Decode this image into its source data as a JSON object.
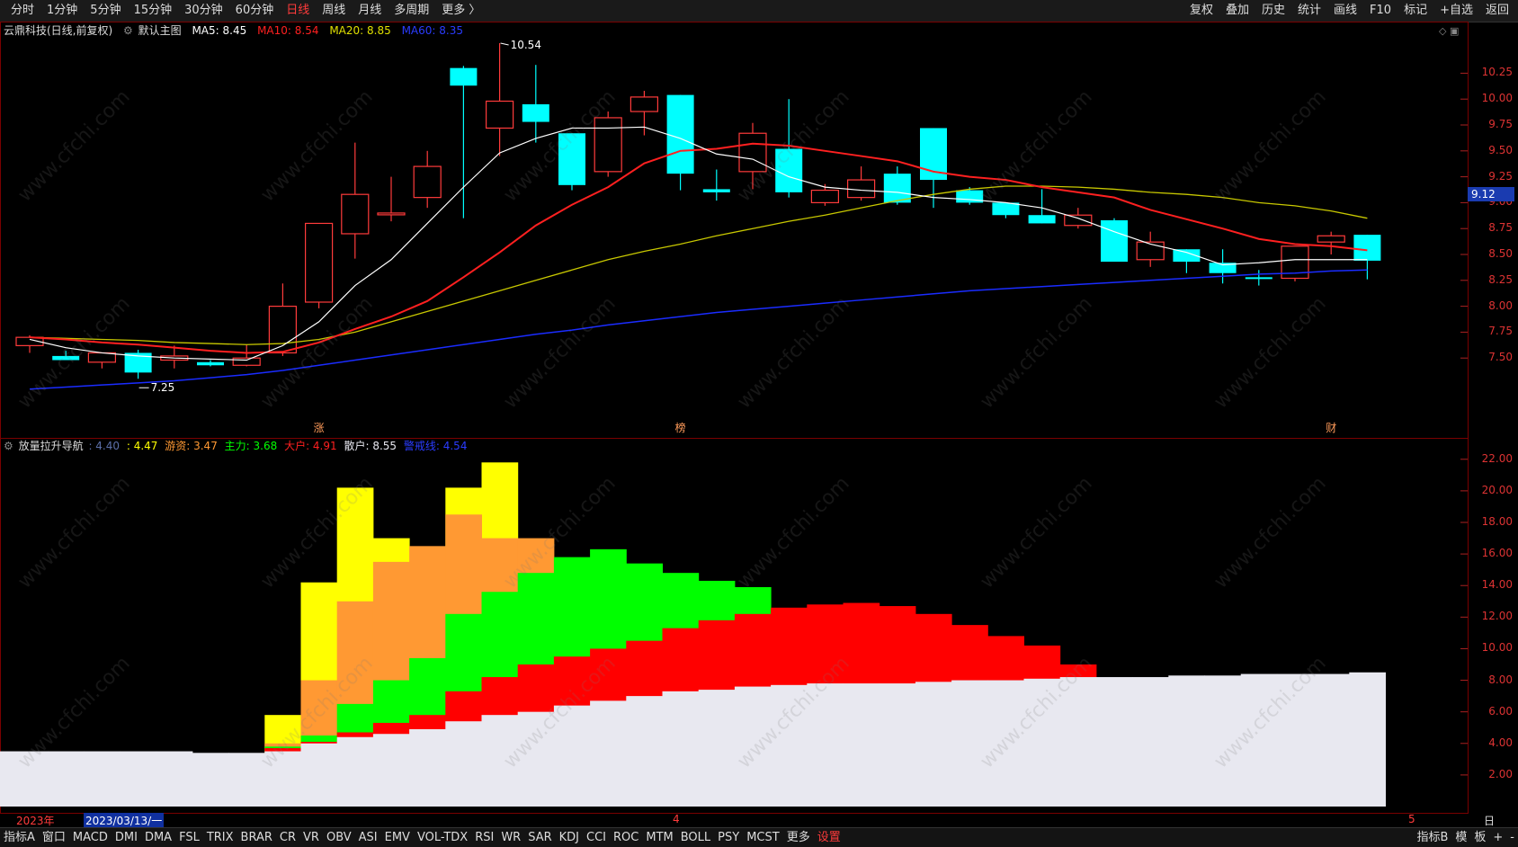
{
  "topbar": {
    "periods": [
      "分时",
      "1分钟",
      "5分钟",
      "15分钟",
      "30分钟",
      "60分钟",
      "日线",
      "周线",
      "月线",
      "多周期",
      "更多 〉"
    ],
    "active_period": "日线",
    "tools": [
      "复权",
      "叠加",
      "历史",
      "统计",
      "画线",
      "F10",
      "标记",
      "+自选",
      "返回"
    ]
  },
  "main_info": {
    "stock": "云鼎科技(日线,前复权)",
    "indicator": "默认主图",
    "ma5": "MA5: 8.45",
    "ma10": "MA10: 8.54",
    "ma20": "MA20: 8.85",
    "ma60": "MA60: 8.35"
  },
  "main_chart": {
    "high_label": "10.54",
    "low_label": "7.25",
    "current_price": "9.12",
    "yticks": [
      "10.25",
      "10.00",
      "9.75",
      "9.50",
      "9.25",
      "9.00",
      "8.75",
      "8.50",
      "8.25",
      "8.00",
      "7.75",
      "7.50"
    ],
    "markers": [
      "涨",
      "榜",
      "财"
    ]
  },
  "sub_info": {
    "name": "放量拉升导航",
    "v1": ": 4.40",
    "v2": ": 4.47",
    "youzi": "游资: 3.47",
    "zhuli": "主力: 3.68",
    "dahu": "大户: 4.91",
    "sanhu": "散户: 8.55",
    "line": "警戒线: 4.54"
  },
  "sub_chart": {
    "yticks": [
      "22.00",
      "20.00",
      "18.00",
      "16.00",
      "14.00",
      "12.00",
      "10.00",
      "8.00",
      "6.00",
      "4.00",
      "2.00"
    ]
  },
  "date_axis": {
    "year": "2023年",
    "cursor_date": "2023/03/13/一",
    "m4": "4",
    "m5": "5"
  },
  "bottom": {
    "left_label": "指标A",
    "window": "窗口",
    "indicators": [
      "MACD",
      "DMI",
      "DMA",
      "FSL",
      "TRIX",
      "BRAR",
      "CR",
      "VR",
      "OBV",
      "ASI",
      "EMV",
      "VOL-TDX",
      "RSI",
      "WR",
      "SAR",
      "KDJ",
      "CCI",
      "ROC",
      "MTM",
      "BOLL",
      "PSY",
      "MCST",
      "更多"
    ],
    "settings": "设置",
    "right": [
      "指标B",
      "模",
      "板",
      "+",
      "-"
    ],
    "period_label": "日线"
  },
  "colors": {
    "up": "#ff3b3b",
    "down": "#00ffff",
    "ma5": "#ffffff",
    "ma10": "#ff2020",
    "ma20": "#c8c800",
    "ma60": "#1a2cff",
    "sanhu": "#e8e8f0",
    "dahu": "#ff0000",
    "zhuli": "#00ff00",
    "youzi": "#ff9933",
    "top": "#ffff00"
  },
  "watermark": "www.cfchi.com",
  "chart_data": {
    "type": "candlestick",
    "candles": [
      {
        "o": 7.62,
        "h": 7.72,
        "l": 7.55,
        "c": 7.7
      },
      {
        "o": 7.52,
        "h": 7.57,
        "l": 7.48,
        "c": 7.48
      },
      {
        "o": 7.46,
        "h": 7.55,
        "l": 7.4,
        "c": 7.55
      },
      {
        "o": 7.55,
        "h": 7.58,
        "l": 7.3,
        "c": 7.36
      },
      {
        "o": 7.48,
        "h": 7.62,
        "l": 7.4,
        "c": 7.52
      },
      {
        "o": 7.46,
        "h": 7.48,
        "l": 7.42,
        "c": 7.43
      },
      {
        "o": 7.43,
        "h": 7.63,
        "l": 7.42,
        "c": 7.5
      },
      {
        "o": 7.55,
        "h": 8.22,
        "l": 7.52,
        "c": 8.0
      },
      {
        "o": 8.04,
        "h": 8.55,
        "l": 7.98,
        "c": 8.8
      },
      {
        "o": 8.7,
        "h": 9.58,
        "l": 8.46,
        "c": 9.08
      },
      {
        "o": 8.9,
        "h": 9.25,
        "l": 8.82,
        "c": 8.9
      },
      {
        "o": 9.05,
        "h": 9.5,
        "l": 8.95,
        "c": 9.35
      },
      {
        "o": 10.3,
        "h": 10.32,
        "l": 8.85,
        "c": 10.13
      },
      {
        "o": 9.72,
        "h": 10.54,
        "l": 9.45,
        "c": 9.98
      },
      {
        "o": 9.95,
        "h": 10.33,
        "l": 9.58,
        "c": 9.78
      },
      {
        "o": 9.67,
        "h": 9.67,
        "l": 9.12,
        "c": 9.17
      },
      {
        "o": 9.3,
        "h": 9.88,
        "l": 9.25,
        "c": 9.82
      },
      {
        "o": 9.88,
        "h": 10.08,
        "l": 9.65,
        "c": 10.02
      },
      {
        "o": 10.04,
        "h": 10.04,
        "l": 9.12,
        "c": 9.28
      },
      {
        "o": 9.13,
        "h": 9.32,
        "l": 9.02,
        "c": 9.1
      },
      {
        "o": 9.3,
        "h": 9.77,
        "l": 9.13,
        "c": 9.67
      },
      {
        "o": 9.52,
        "h": 10.0,
        "l": 9.05,
        "c": 9.1
      },
      {
        "o": 9.0,
        "h": 9.18,
        "l": 8.97,
        "c": 9.12
      },
      {
        "o": 9.05,
        "h": 9.35,
        "l": 9.02,
        "c": 9.22
      },
      {
        "o": 9.28,
        "h": 9.35,
        "l": 8.98,
        "c": 9.0
      },
      {
        "o": 9.72,
        "h": 9.72,
        "l": 8.95,
        "c": 9.22
      },
      {
        "o": 9.12,
        "h": 9.15,
        "l": 8.98,
        "c": 9.0
      },
      {
        "o": 9.0,
        "h": 9.0,
        "l": 8.85,
        "c": 8.88
      },
      {
        "o": 8.88,
        "h": 9.13,
        "l": 8.8,
        "c": 8.8
      },
      {
        "o": 8.78,
        "h": 8.95,
        "l": 8.75,
        "c": 8.88
      },
      {
        "o": 8.83,
        "h": 8.85,
        "l": 8.45,
        "c": 8.43
      },
      {
        "o": 8.45,
        "h": 8.72,
        "l": 8.38,
        "c": 8.62
      },
      {
        "o": 8.55,
        "h": 8.55,
        "l": 8.32,
        "c": 8.43
      },
      {
        "o": 8.42,
        "h": 8.55,
        "l": 8.22,
        "c": 8.32
      },
      {
        "o": 8.28,
        "h": 8.35,
        "l": 8.2,
        "c": 8.27
      },
      {
        "o": 8.27,
        "h": 8.58,
        "l": 8.24,
        "c": 8.58
      },
      {
        "o": 8.62,
        "h": 8.72,
        "l": 8.5,
        "c": 8.68
      },
      {
        "o": 8.69,
        "h": 8.69,
        "l": 8.26,
        "c": 8.44
      }
    ],
    "ma5": [
      7.68,
      7.6,
      7.55,
      7.52,
      7.5,
      7.49,
      7.48,
      7.62,
      7.85,
      8.2,
      8.45,
      8.8,
      9.15,
      9.48,
      9.62,
      9.72,
      9.72,
      9.73,
      9.62,
      9.47,
      9.42,
      9.25,
      9.15,
      9.12,
      9.1,
      9.05,
      9.03,
      9.0,
      8.95,
      8.85,
      8.72,
      8.6,
      8.52,
      8.4,
      8.42,
      8.45,
      8.45,
      8.45
    ],
    "ma10": [
      7.7,
      7.68,
      7.65,
      7.63,
      7.6,
      7.57,
      7.55,
      7.56,
      7.65,
      7.78,
      7.9,
      8.05,
      8.28,
      8.52,
      8.78,
      8.98,
      9.15,
      9.38,
      9.5,
      9.52,
      9.57,
      9.55,
      9.5,
      9.45,
      9.4,
      9.3,
      9.25,
      9.22,
      9.15,
      9.1,
      9.05,
      8.93,
      8.84,
      8.75,
      8.65,
      8.6,
      8.58,
      8.54
    ],
    "ma20": [
      7.7,
      7.69,
      7.68,
      7.67,
      7.65,
      7.64,
      7.63,
      7.64,
      7.68,
      7.75,
      7.85,
      7.95,
      8.05,
      8.15,
      8.25,
      8.35,
      8.45,
      8.53,
      8.6,
      8.68,
      8.75,
      8.82,
      8.88,
      8.95,
      9.02,
      9.08,
      9.13,
      9.16,
      9.16,
      9.15,
      9.13,
      9.1,
      9.08,
      9.05,
      9.0,
      8.97,
      8.92,
      8.85
    ],
    "ma60": [
      7.2,
      7.22,
      7.24,
      7.26,
      7.28,
      7.31,
      7.34,
      7.38,
      7.43,
      7.48,
      7.53,
      7.58,
      7.63,
      7.68,
      7.73,
      7.77,
      7.82,
      7.86,
      7.9,
      7.94,
      7.97,
      8.0,
      8.03,
      8.06,
      8.09,
      8.12,
      8.15,
      8.17,
      8.19,
      8.21,
      8.23,
      8.25,
      8.27,
      8.29,
      8.31,
      8.32,
      8.34,
      8.35
    ],
    "sub_layers": {
      "sanhu": [
        3.5,
        3.5,
        3.5,
        3.5,
        3.5,
        3.4,
        3.4,
        3.5,
        4.0,
        4.4,
        4.6,
        4.9,
        5.4,
        5.8,
        6.0,
        6.4,
        6.7,
        7.0,
        7.3,
        7.4,
        7.6,
        7.7,
        7.8,
        7.8,
        7.8,
        7.9,
        8.0,
        8.0,
        8.1,
        8.2,
        8.2,
        8.2,
        8.3,
        8.3,
        8.4,
        8.4,
        8.4,
        8.5
      ],
      "dahu": [
        0,
        0,
        0,
        0,
        0,
        0,
        0,
        3.7,
        4.1,
        4.7,
        5.3,
        5.8,
        7.3,
        8.2,
        9.0,
        9.5,
        10.0,
        10.5,
        11.3,
        11.8,
        12.2,
        12.6,
        12.8,
        12.9,
        12.7,
        12.2,
        11.5,
        10.8,
        10.2,
        9.0,
        8.1,
        0,
        0,
        0,
        0,
        0,
        0,
        0
      ],
      "zhuli": [
        0,
        0,
        0,
        0,
        0,
        0,
        0,
        3.8,
        4.5,
        6.5,
        8.0,
        9.4,
        12.2,
        13.6,
        14.8,
        15.8,
        16.3,
        15.4,
        14.8,
        14.3,
        13.9,
        0,
        0,
        0,
        0,
        0,
        0,
        0,
        0,
        0,
        0,
        0,
        0,
        0,
        0,
        0,
        0,
        0
      ],
      "youzi": [
        0,
        0,
        0,
        0,
        0,
        0,
        0,
        4.0,
        8.0,
        13.0,
        15.5,
        16.5,
        18.5,
        17.0,
        17.0,
        0,
        0,
        0,
        0,
        0,
        0,
        0,
        0,
        0,
        0,
        0,
        0,
        0,
        0,
        0,
        0,
        0,
        0,
        0,
        0,
        0,
        0,
        0
      ],
      "top": [
        0,
        0,
        0,
        0,
        0,
        0,
        0,
        5.8,
        14.2,
        20.2,
        17.0,
        0,
        20.2,
        21.8,
        0,
        0,
        0,
        0,
        0,
        0,
        0,
        0,
        0,
        0,
        0,
        0,
        0,
        0,
        0,
        0,
        0,
        0,
        0,
        0,
        0,
        0,
        0,
        0
      ]
    }
  }
}
